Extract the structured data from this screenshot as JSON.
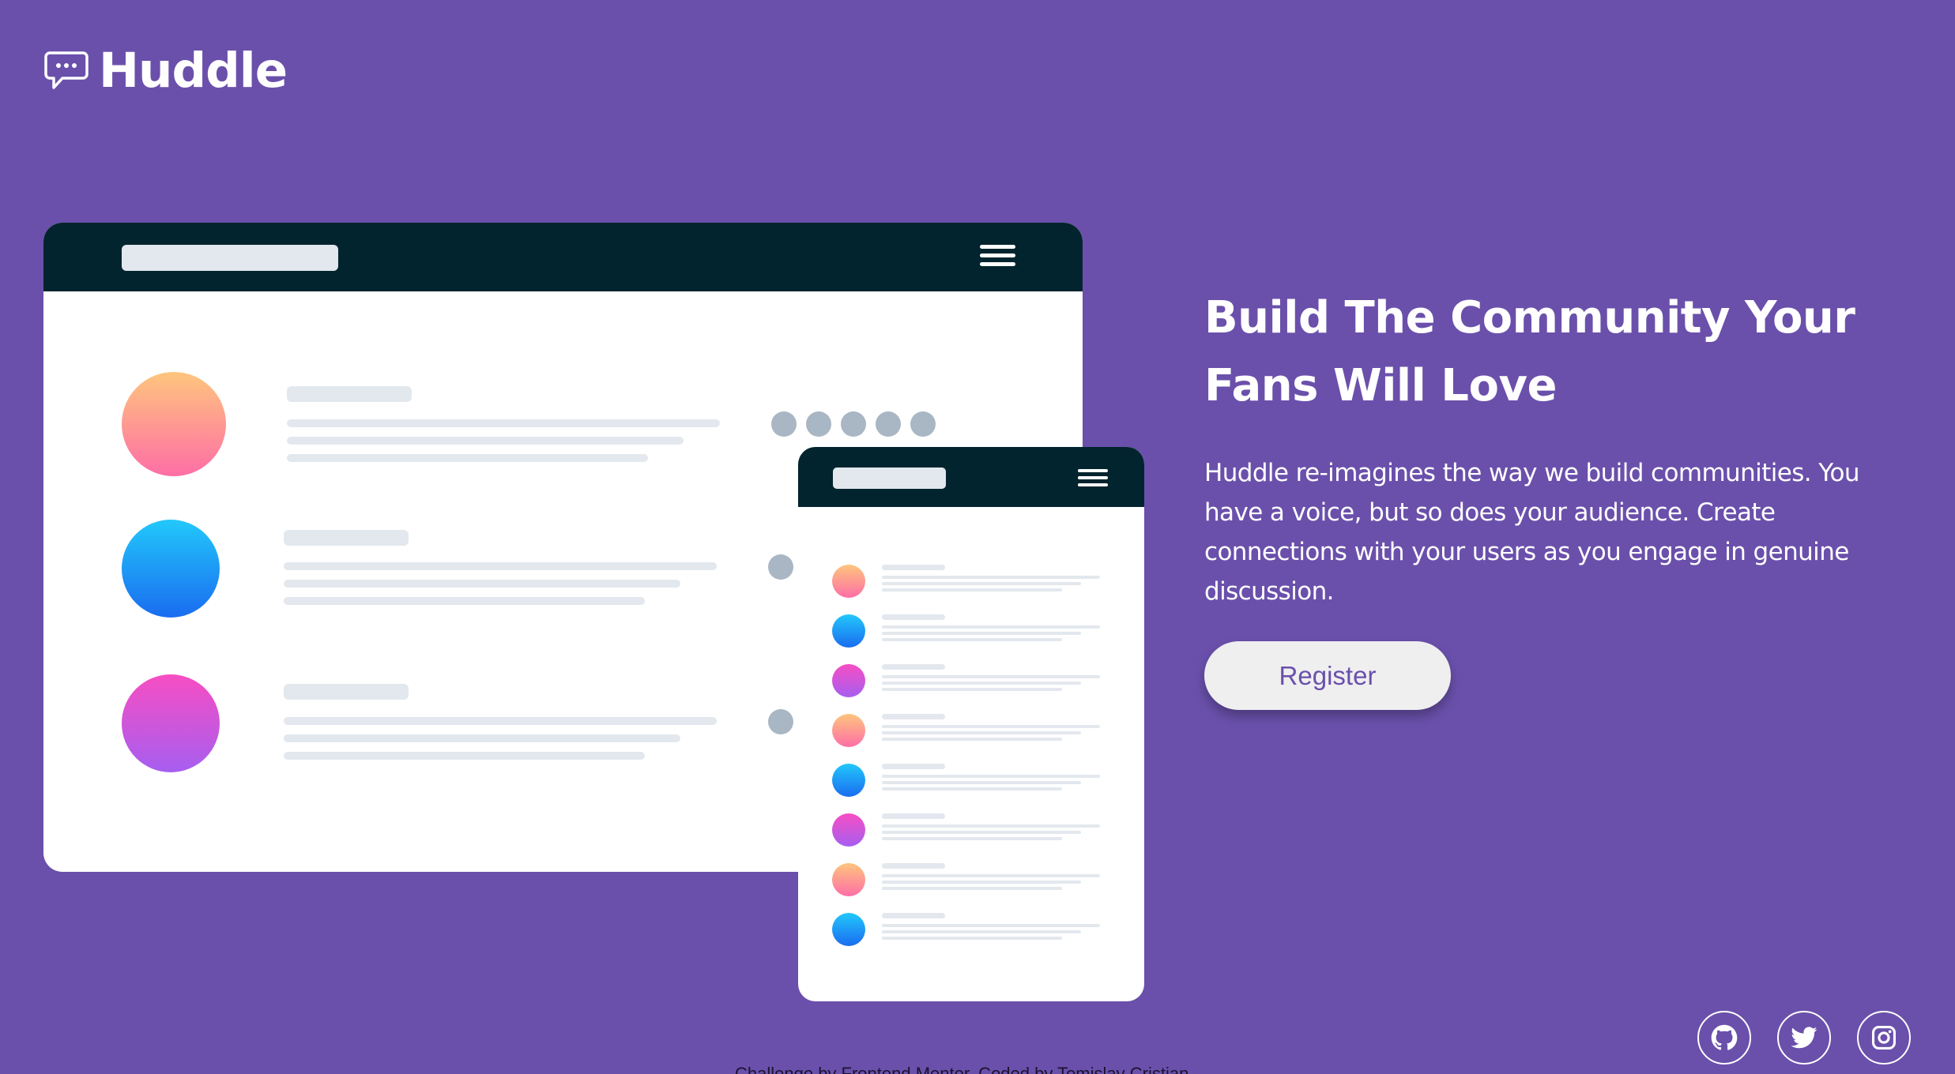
{
  "brand": {
    "name": "Huddle",
    "logo_icon": "chat-bubble-icon"
  },
  "hero": {
    "title": "Build The Community Your Fans Will Love",
    "description": "Huddle re-imagines the way we build communities. You have a voice, but so does your audience. Create connections with your users as you engage in genuine discussion.",
    "cta_label": "Register"
  },
  "illustration": {
    "desktop_rows": [
      "orange",
      "blue",
      "pink"
    ],
    "mobile_rows": [
      "orange",
      "blue",
      "pink",
      "orange",
      "blue",
      "pink",
      "orange",
      "blue"
    ]
  },
  "socials": [
    {
      "icon": "github-icon"
    },
    {
      "icon": "twitter-icon"
    },
    {
      "icon": "instagram-icon"
    }
  ],
  "footer": {
    "attribution": "Challenge by Frontend Mentor. Coded by Tomislav Cristian."
  },
  "colors": {
    "background": "#6a50ab",
    "window_bar": "#02242e",
    "button_bg": "#efeff0",
    "button_text": "#6a50ab"
  }
}
